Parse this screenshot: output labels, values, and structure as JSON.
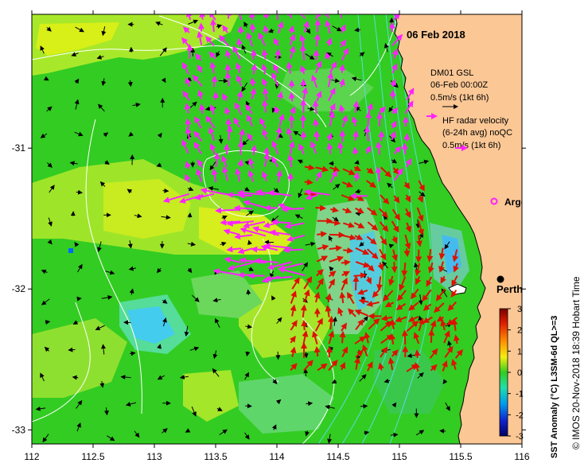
{
  "map": {
    "date": "06 Feb 2018",
    "x_ticks": [
      "112",
      "112.5",
      "113",
      "113.5",
      "114",
      "114.5",
      "115",
      "115.5",
      "116"
    ],
    "y_ticks": [
      "-31",
      "-32",
      "-33"
    ],
    "lon_range": [
      112,
      116
    ],
    "lat_range": [
      -30.05,
      -33.1
    ],
    "legend": {
      "model_line1": "DM01 GSL",
      "model_line2": "06-Feb 00:00Z",
      "model_scale": "0.5m/s (1kt 6h)",
      "radar_line1": "HF radar velocity",
      "radar_line2": "(6-24h avg) noQC",
      "radar_scale": "0.5m/s (1kt 6h)",
      "argo_label": "Argo"
    },
    "city": {
      "name": "Perth",
      "lon": 115.86,
      "lat": -31.95
    },
    "argo": {
      "lon": 115.75,
      "lat": -31.4
    },
    "colorbar": {
      "ticks": [
        "3",
        "2",
        "1",
        "0",
        "-1",
        "-2",
        "-3"
      ],
      "label": "SST Anomaly (°C) L3SM-6d QL>=3"
    },
    "credit": "© IMOS 20-Nov-2018 18:39 Hobart Time",
    "colors": {
      "land": "#fbc795",
      "ocean_base": "#33cc22",
      "radar_north": "#ff22ff",
      "radar_south": "#dd1100",
      "model_arrows": "#000000",
      "contours": "#ffffff",
      "shelf_contours": "#55dddd"
    }
  }
}
